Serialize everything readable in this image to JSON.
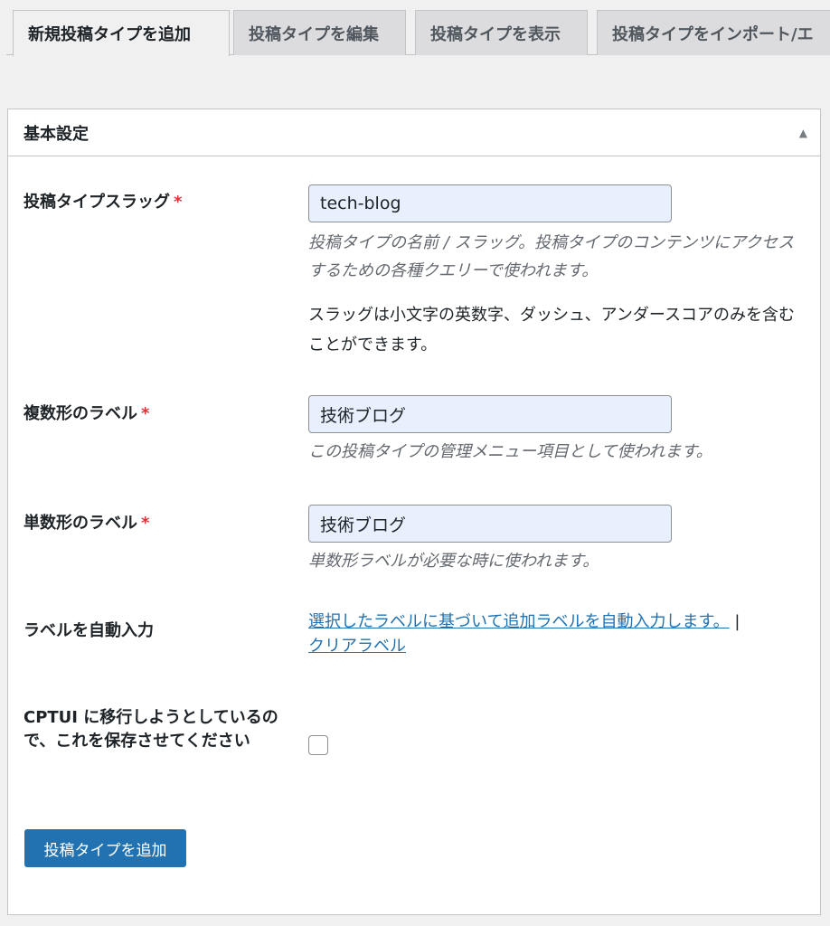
{
  "tabs": [
    {
      "label": "新規投稿タイプを追加",
      "active": true
    },
    {
      "label": "投稿タイプを編集"
    },
    {
      "label": "投稿タイプを表示"
    },
    {
      "label": "投稿タイプをインポート/エ"
    }
  ],
  "panel": {
    "title": "基本設定",
    "toggle_icon": "▲"
  },
  "fields": {
    "slug": {
      "label": "投稿タイプスラッグ",
      "required_mark": "*",
      "value": "tech-blog",
      "description": "投稿タイプの名前 / スラッグ。投稿タイプのコンテンツにアクセスするための各種クエリーで使われます。",
      "note": "スラッグは小文字の英数字、ダッシュ、アンダースコアのみを含むことができます。"
    },
    "plural": {
      "label": "複数形のラベル",
      "required_mark": "*",
      "value": "技術ブログ",
      "description": "この投稿タイプの管理メニュー項目として使われます。"
    },
    "singular": {
      "label": "単数形のラベル",
      "required_mark": "*",
      "value": "技術ブログ",
      "description": "単数形ラベルが必要な時に使われます。"
    },
    "autofill": {
      "label": "ラベルを自動入力",
      "link1": "選択したラベルに基づいて追加ラベルを自動入力します。",
      "separator": "|",
      "link2": "クリアラベル"
    },
    "migrate": {
      "label": "CPTUI に移行しようとしているので、これを保存させてください",
      "checked": false
    }
  },
  "submit_label": "投稿タイプを追加"
}
